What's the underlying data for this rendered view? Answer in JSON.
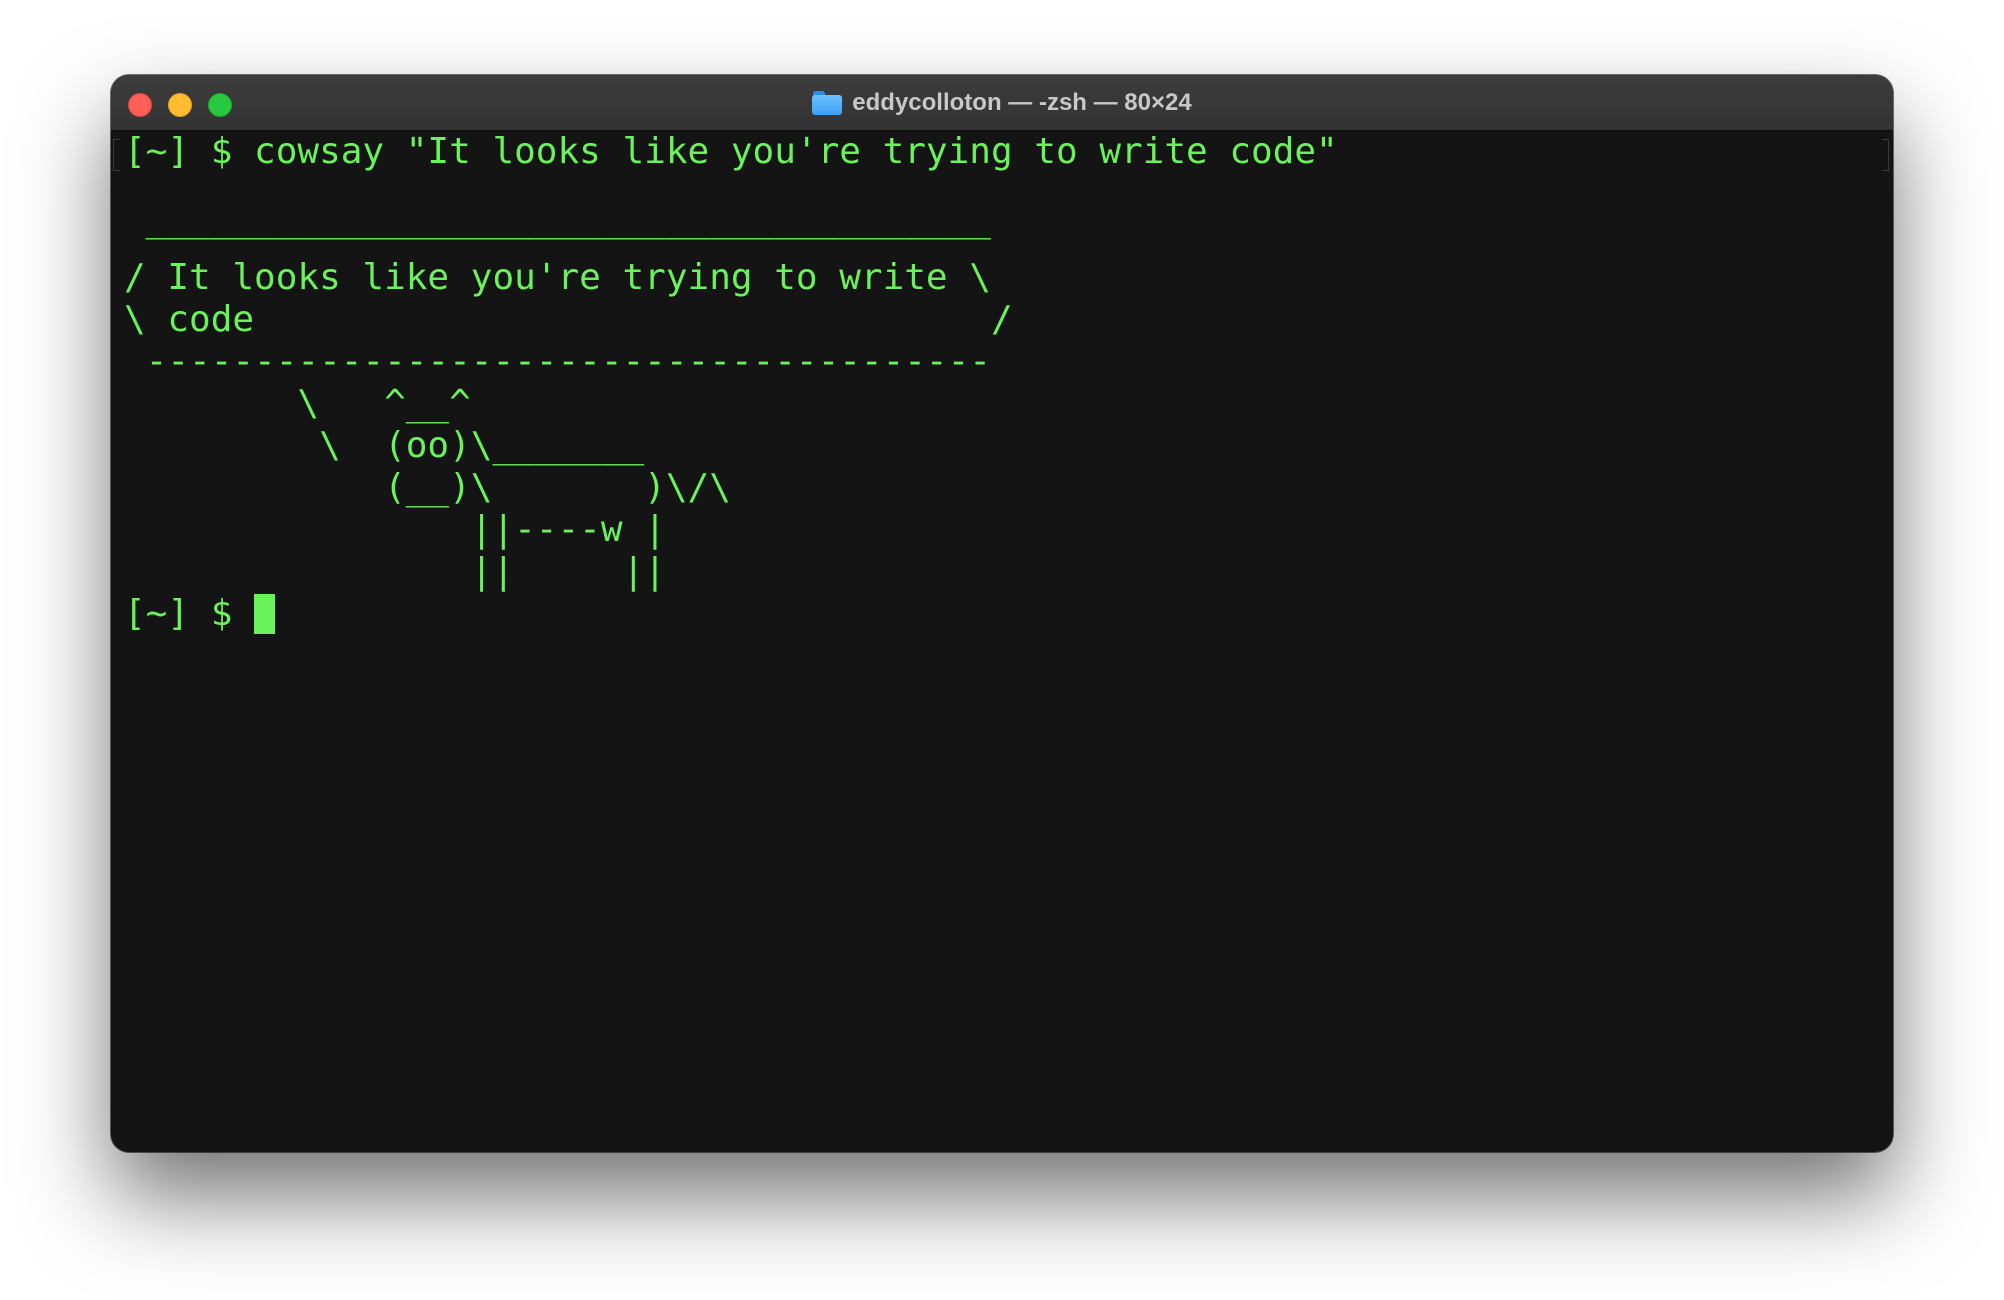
{
  "window": {
    "title": "eddycolloton — -zsh — 80×24",
    "title_icon": "folder-icon"
  },
  "terminal": {
    "colors": {
      "background": "#141414",
      "foreground": "#6af25a",
      "titlebar": "#383838"
    },
    "command_line": "[~] $ cowsay \"It looks like you're trying to write code\"",
    "blank_line": "",
    "bubble_top": " _______________________________________",
    "bubble_line_1": "/ It looks like you're trying to write \\",
    "bubble_line_2": "\\ code                                  /",
    "bubble_bottom": " ---------------------------------------",
    "cow_line_1": "        \\   ^__^",
    "cow_line_2": "         \\  (oo)\\_______",
    "cow_line_3": "            (__)\\       )\\/\\",
    "cow_line_4": "                ||----w |",
    "cow_line_5": "                ||     ||",
    "prompt": "[~] $ "
  }
}
